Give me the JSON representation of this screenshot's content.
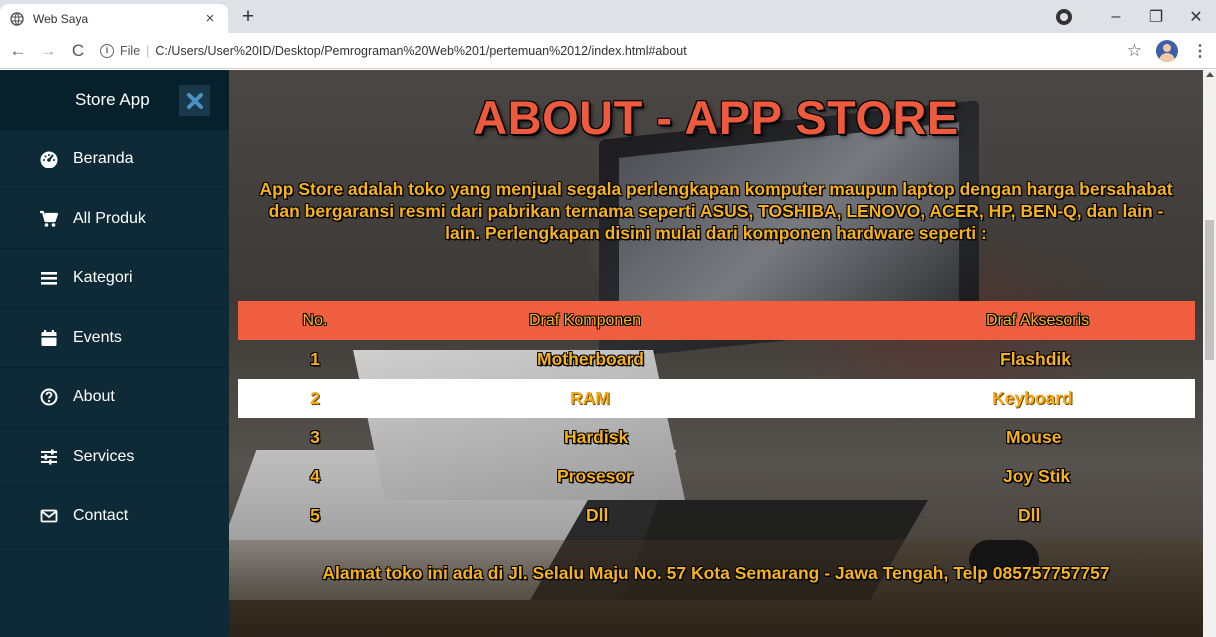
{
  "browser": {
    "tab_title": "Web Saya",
    "tab_close": "×",
    "new_tab": "+",
    "url_scheme_label": "File",
    "url_separator": "|",
    "url_path": "C:/Users/User%20ID/Desktop/Pemrograman%20Web%201/pertemuan%2012/index.html#about",
    "win_minimize": "–",
    "win_restore": "❐",
    "win_close": "✕",
    "back": "←",
    "forward": "→",
    "reload": "C",
    "star": "☆",
    "menu": "⋮"
  },
  "sidebar": {
    "title": "Store App",
    "items": [
      {
        "label": "Beranda",
        "icon": "tachometer-icon"
      },
      {
        "label": "All Produk",
        "icon": "cart-icon"
      },
      {
        "label": "Kategori",
        "icon": "list-icon"
      },
      {
        "label": "Events",
        "icon": "calendar-icon"
      },
      {
        "label": "About",
        "icon": "question-circle-icon"
      },
      {
        "label": "Services",
        "icon": "sliders-icon"
      },
      {
        "label": "Contact",
        "icon": "envelope-icon"
      }
    ]
  },
  "main": {
    "title": "ABOUT - APP STORE",
    "intro": "App Store adalah toko yang menjual segala perlengkapan komputer maupun laptop dengan harga bersahabat dan bergaransi resmi dari pabrikan ternama seperti ASUS, TOSHIBA, LENOVO, ACER, HP, BEN-Q, dan lain - lain. Perlengkapan disini mulai dari komponen hardware seperti :",
    "table": {
      "headers": [
        "No.",
        "Draf Komponen",
        "Draf Aksesoris"
      ],
      "rows": [
        [
          "1",
          "Motherboard",
          "Flashdik"
        ],
        [
          "2",
          "RAM",
          "Keyboard"
        ],
        [
          "3",
          "Hardisk",
          "Mouse"
        ],
        [
          "4",
          "Prosesor",
          "Joy Stik"
        ],
        [
          "5",
          "Dll",
          "Dll"
        ]
      ]
    },
    "footer": "Alamat toko ini ada di Jl. Selalu Maju No. 57 Kota Semarang - Jawa Tengah, Telp 085757757757"
  },
  "colors": {
    "sidebar_bg": "#0f2a37",
    "sidebar_header_bg": "#06202c",
    "title_color": "#ee5a3d",
    "text_color": "#f7b21a",
    "table_header_bg": "#ef5e3e",
    "close_icon_color": "#4a90c2"
  }
}
